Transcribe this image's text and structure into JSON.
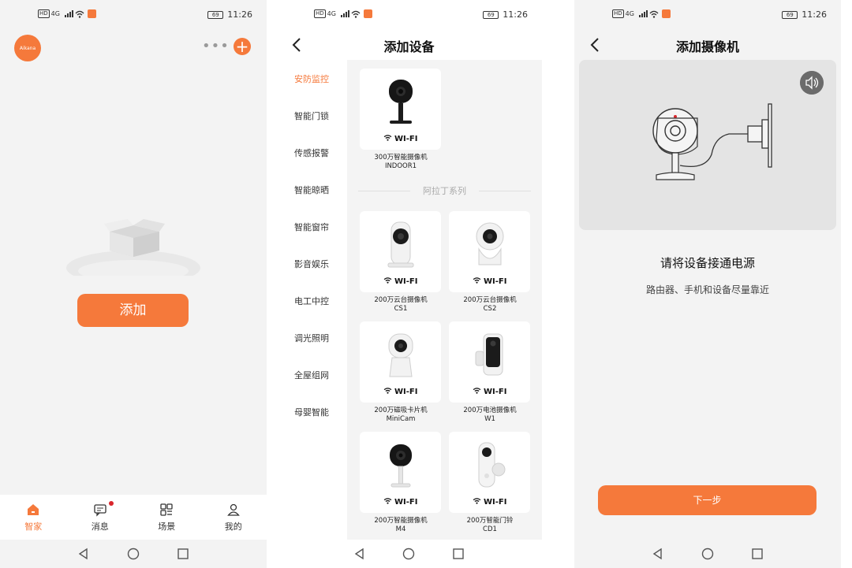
{
  "status": {
    "time": "11:26",
    "battery": "69",
    "network": "4G"
  },
  "screen1": {
    "logo_text": "Aikana",
    "add_label": "添加",
    "tabs": [
      {
        "label": "智家",
        "icon": "home-icon"
      },
      {
        "label": "消息",
        "icon": "message-icon"
      },
      {
        "label": "场景",
        "icon": "scene-icon"
      },
      {
        "label": "我的",
        "icon": "profile-icon"
      }
    ]
  },
  "screen2": {
    "title": "添加设备",
    "categories": [
      "安防监控",
      "智能门锁",
      "传感报警",
      "智能晾晒",
      "智能窗帘",
      "影音娱乐",
      "电工中控",
      "调光照明",
      "全屋组网",
      "母婴智能"
    ],
    "series_title": "阿拉丁系列",
    "wifi_label": "WI-FI",
    "devices": [
      {
        "name": "300万智能摄像机",
        "model": "INDOOR1"
      },
      {
        "name": "200万云台摄像机",
        "model": "CS1"
      },
      {
        "name": "200万云台摄像机",
        "model": "CS2"
      },
      {
        "name": "200万磁吸卡片机",
        "model": "MiniCam"
      },
      {
        "name": "200万电池摄像机",
        "model": "W1"
      },
      {
        "name": "200万智能摄像机",
        "model": "M4"
      },
      {
        "name": "200万智能门铃",
        "model": "CD1"
      }
    ]
  },
  "screen3": {
    "title": "添加摄像机",
    "instruction": "请将设备接通电源",
    "hint": "路由器、手机和设备尽量靠近",
    "next_label": "下一步"
  },
  "colors": {
    "accent": "#f5793b",
    "badge": "#d9262c"
  }
}
